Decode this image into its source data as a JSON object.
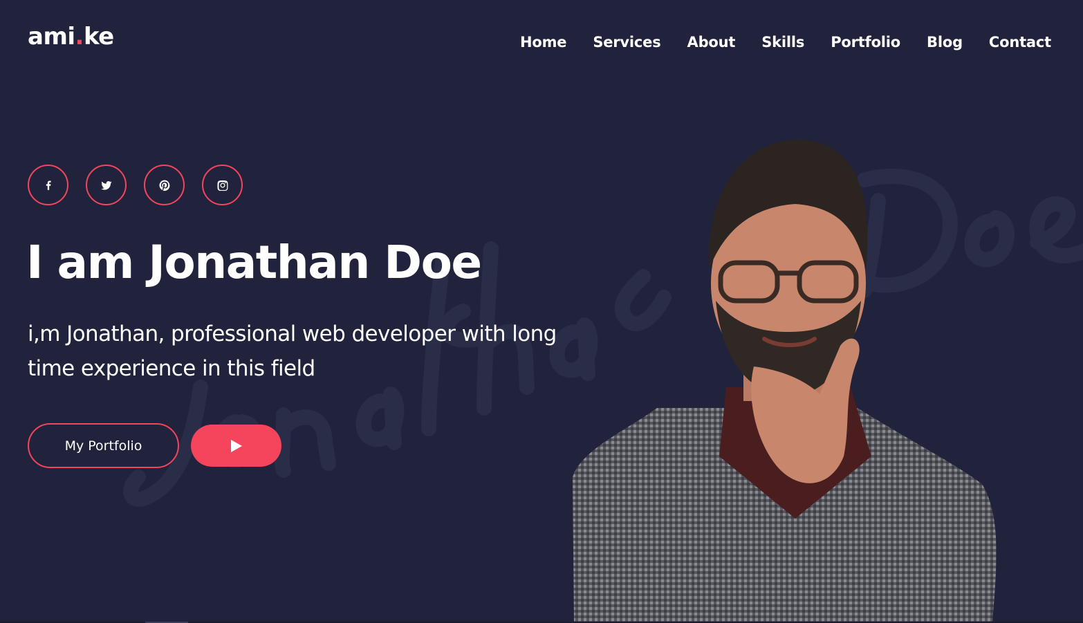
{
  "brand": {
    "logo_part1": "ami",
    "logo_dot": ".",
    "logo_part2": "ke"
  },
  "nav": [
    "Home",
    "Services",
    "About",
    "Skills",
    "Portfolio",
    "Blog",
    "Contact"
  ],
  "socials": [
    "facebook-icon",
    "twitter-icon",
    "pinterest-icon",
    "instagram-icon"
  ],
  "hero": {
    "title": "I am Jonathan Doe",
    "description": "i,m Jonathan, professional web developer with long time experience in this field",
    "portfolio_button": "My Portfolio",
    "watermark": "Jonathan Doe"
  },
  "colors": {
    "background": "#21233c",
    "accent": "#f5455c",
    "text": "#ffffff"
  }
}
